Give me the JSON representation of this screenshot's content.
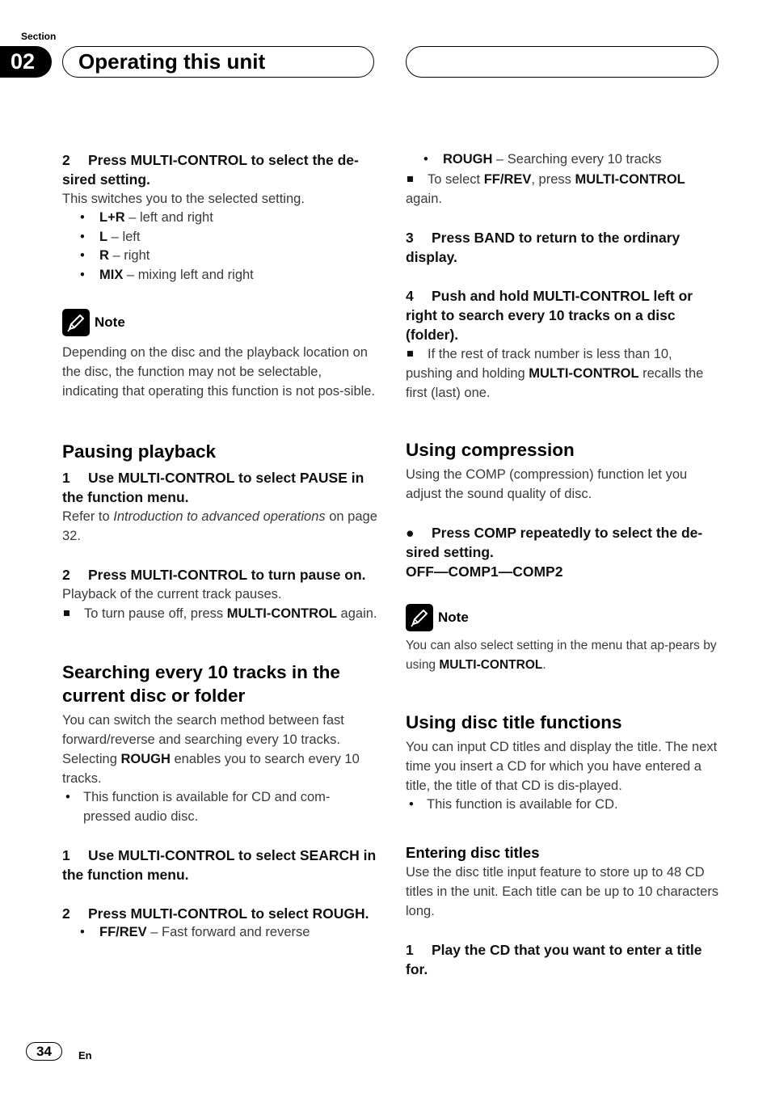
{
  "header": {
    "section_label": "Section",
    "section_number": "02",
    "title": "Operating this unit"
  },
  "left": {
    "step2_select": {
      "num": "2",
      "text": "Press MULTI-CONTROL to select the de-sired setting.",
      "desc": "This switches you to the selected setting.",
      "options": [
        {
          "key": "L+R",
          "desc": " – left and right"
        },
        {
          "key": "L",
          "desc": " – left"
        },
        {
          "key": "R",
          "desc": " – right"
        },
        {
          "key": "MIX",
          "desc": " – mixing left and right"
        }
      ]
    },
    "note1": {
      "label": "Note",
      "text": "Depending on the disc and the playback location on the disc, the function may not be selectable, indicating that operating this function is not pos-sible."
    },
    "pausing": {
      "heading": "Pausing playback",
      "step1": {
        "num": "1",
        "text": "Use MULTI-CONTROL to select PAUSE in the function menu."
      },
      "step1_desc_pre": "Refer to ",
      "step1_desc_link": "Introduction to advanced operations",
      "step1_desc_post": " on page 32.",
      "step2": {
        "num": "2",
        "text": "Press MULTI-CONTROL to turn pause on."
      },
      "step2_desc": "Playback of the current track pauses.",
      "tip_pre": "To turn pause off, press ",
      "tip_bold": "MULTI-CONTROL",
      "tip_post": " again."
    },
    "searching": {
      "heading": "Searching every 10 tracks in the current disc or folder",
      "intro_pre": "You can switch the search method between fast forward/reverse and searching every 10 tracks. Selecting ",
      "intro_bold": "ROUGH",
      "intro_post": " enables you to search every 10 tracks.",
      "bullet": "This function is available for CD and com-pressed audio disc.",
      "step1": {
        "num": "1",
        "text": "Use MULTI-CONTROL to select SEARCH in the function menu."
      },
      "step2": {
        "num": "2",
        "text": "Press MULTI-CONTROL to select ROUGH."
      },
      "options": [
        {
          "key": "FF/REV",
          "desc": " – Fast forward and reverse"
        }
      ]
    }
  },
  "right": {
    "searching_cont": {
      "options": [
        {
          "key": "ROUGH",
          "desc": " – Searching every 10 tracks"
        }
      ],
      "tip_pre": "To select ",
      "tip_b1": "FF/REV",
      "tip_mid": ", press ",
      "tip_b2": "MULTI-CONTROL",
      "tip_post": " again.",
      "step3": {
        "num": "3",
        "text": "Press BAND to return to the ordinary display."
      },
      "step4": {
        "num": "4",
        "text": "Push and hold MULTI-CONTROL left or right to search every 10 tracks on a disc (folder)."
      },
      "tip2_pre": "If the rest of track number is less than 10, pushing and holding ",
      "tip2_bold": "MULTI-CONTROL",
      "tip2_post": " recalls the first (last) one."
    },
    "compression": {
      "heading": "Using compression",
      "intro": "Using the COMP (compression) function let you adjust the sound quality of disc.",
      "step": "Press COMP repeatedly to select the de-sired setting.",
      "sequence": "OFF—COMP1—COMP2",
      "note_label": "Note",
      "note_pre": "You can also select setting in the menu that ap-pears by using ",
      "note_bold": "MULTI-CONTROL",
      "note_post": "."
    },
    "disc_title": {
      "heading": "Using disc title functions",
      "intro": "You can input CD titles and display the title. The next time you insert a CD for which you have entered a title, the title of that CD is dis-played.",
      "bullet": "This function is available for CD.",
      "subheading": "Entering disc titles",
      "sub_intro": "Use the disc title input feature to store up to 48 CD titles in the unit. Each title can be up to 10 characters long.",
      "step1": {
        "num": "1",
        "text": "Play the CD that you want to enter a title for."
      }
    }
  },
  "footer": {
    "page_number": "34",
    "language": "En"
  }
}
